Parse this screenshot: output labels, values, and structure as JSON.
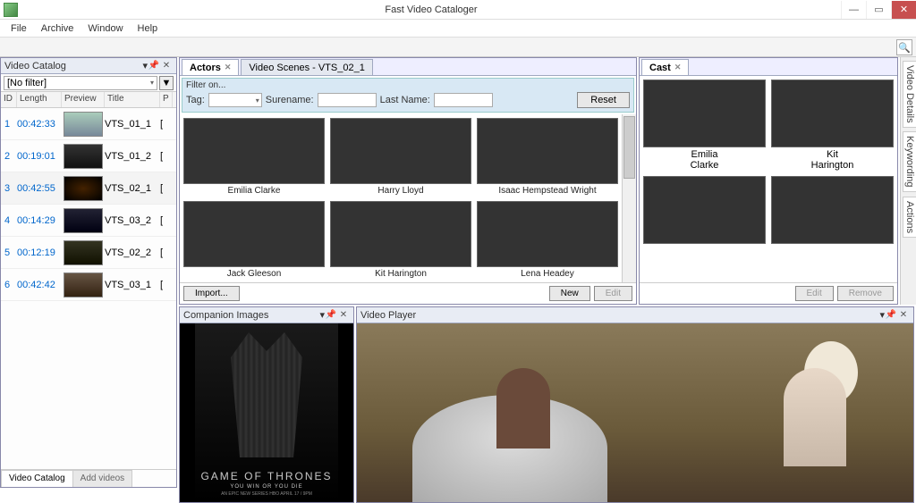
{
  "app": {
    "title": "Fast Video Cataloger"
  },
  "menu": {
    "file": "File",
    "archive": "Archive",
    "window": "Window",
    "help": "Help"
  },
  "leftPane": {
    "title": "Video Catalog",
    "filterText": "[No filter]",
    "cols": {
      "id": "ID",
      "length": "Length",
      "preview": "Preview",
      "title": "Title",
      "p": "P"
    },
    "rows": [
      {
        "id": "1",
        "len": "00:42:33",
        "title": "VTS_01_1",
        "p": "["
      },
      {
        "id": "2",
        "len": "00:19:01",
        "title": "VTS_01_2",
        "p": "["
      },
      {
        "id": "3",
        "len": "00:42:55",
        "title": "VTS_02_1",
        "p": "["
      },
      {
        "id": "4",
        "len": "00:14:29",
        "title": "VTS_03_2",
        "p": "["
      },
      {
        "id": "5",
        "len": "00:12:19",
        "title": "VTS_02_2",
        "p": "["
      },
      {
        "id": "6",
        "len": "00:42:42",
        "title": "VTS_03_1",
        "p": "["
      }
    ],
    "tabs": {
      "catalog": "Video Catalog",
      "add": "Add videos"
    }
  },
  "docTabs": {
    "actors": "Actors",
    "scenes": "Video Scenes - VTS_02_1"
  },
  "filter": {
    "label": "Filter on...",
    "tag": "Tag:",
    "surname": "Surename:",
    "lastname": "Last Name:",
    "reset": "Reset"
  },
  "actors": [
    {
      "name": "Emilia Clarke"
    },
    {
      "name": "Harry Lloyd"
    },
    {
      "name": "Isaac Hempstead Wright"
    },
    {
      "name": "Jack Gleeson"
    },
    {
      "name": "Kit Harington"
    },
    {
      "name": "Lena Headey"
    }
  ],
  "actorBtns": {
    "import": "Import...",
    "new": "New",
    "edit": "Edit"
  },
  "cast": {
    "title": "Cast",
    "items": [
      {
        "first": "Emilia",
        "last": "Clarke"
      },
      {
        "first": "Kit",
        "last": "Harington"
      },
      {
        "first": "",
        "last": ""
      },
      {
        "first": "",
        "last": ""
      }
    ],
    "edit": "Edit",
    "remove": "Remove"
  },
  "sideTabs": {
    "details": "Video Details",
    "keywording": "Keywording",
    "actions": "Actions"
  },
  "companion": {
    "title": "Companion Images"
  },
  "player": {
    "title": "Video Player"
  },
  "poster": {
    "title": "GAME OF THRONES",
    "sub": "YOU WIN OR YOU DIE",
    "meta": "AN EPIC NEW SERIES   HBO   APRIL 17 / 9PM"
  }
}
